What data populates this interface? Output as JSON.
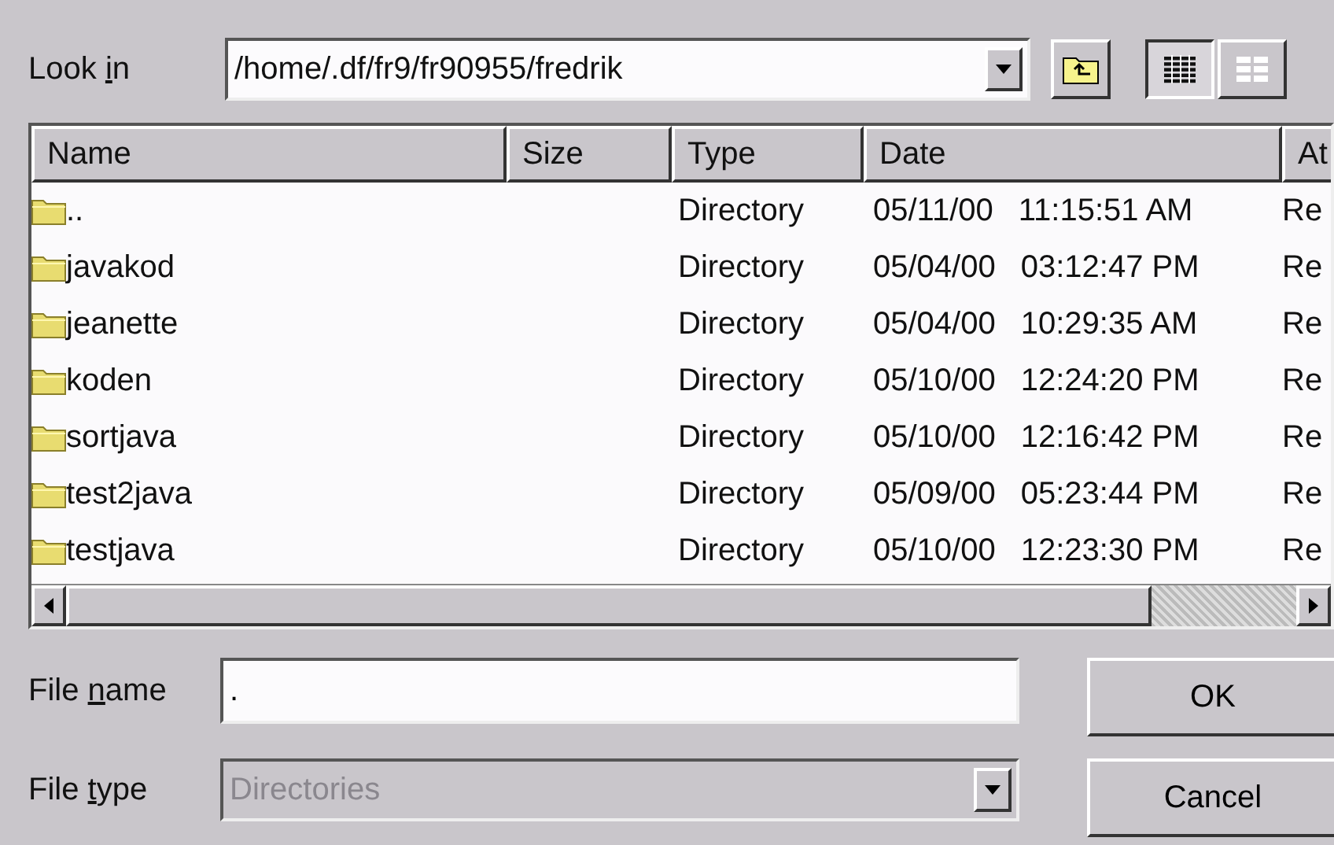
{
  "look_in": {
    "label_start": "Look ",
    "access_key": "i",
    "label_end": "n",
    "value": "/home/.df/fr9/fr90955/fredrik"
  },
  "view_buttons": [
    {
      "kind": "list",
      "selected": true
    },
    {
      "kind": "details",
      "selected": false
    }
  ],
  "table": {
    "columns": [
      "Name",
      "Size",
      "Type",
      "Date",
      "At"
    ],
    "rows": [
      {
        "name": "..",
        "size": "",
        "type": "Directory",
        "date": "05/11/00",
        "time": "11:15:51 AM",
        "column_5": "Re"
      },
      {
        "name": "javakod",
        "type": "Directory",
        "date": "05/04/00",
        "time": "03:12:47 PM",
        "column_5": "Re"
      },
      {
        "name": "jeanette",
        "type": "Directory",
        "date": "05/04/00",
        "time": "10:29:35 AM",
        "column_5": "Re"
      },
      {
        "name": "koden",
        "type": "Directory",
        "date": "05/10/00",
        "time": "12:24:20 PM",
        "column_5": "Re"
      },
      {
        "name": "sortjava",
        "type": "Directory",
        "date": "05/10/00",
        "time": "12:16:42 PM",
        "column_5": "Re"
      },
      {
        "name": "test2java",
        "type": "Directory",
        "date": "05/09/00",
        "time": "05:23:44 PM",
        "column_5": "Re"
      },
      {
        "name": "testjava",
        "type": "Directory",
        "date": "05/10/00",
        "time": "12:23:30 PM",
        "column_5": "Re"
      }
    ]
  },
  "file_name": {
    "label_start": "File ",
    "access_key": "n",
    "label_end": "ame",
    "value": "."
  },
  "file_type": {
    "label_start": "File ",
    "access_key": "t",
    "label_end": "ype",
    "value": "Directories",
    "disabled": true
  },
  "buttons": [
    "OK",
    "Cancel"
  ]
}
